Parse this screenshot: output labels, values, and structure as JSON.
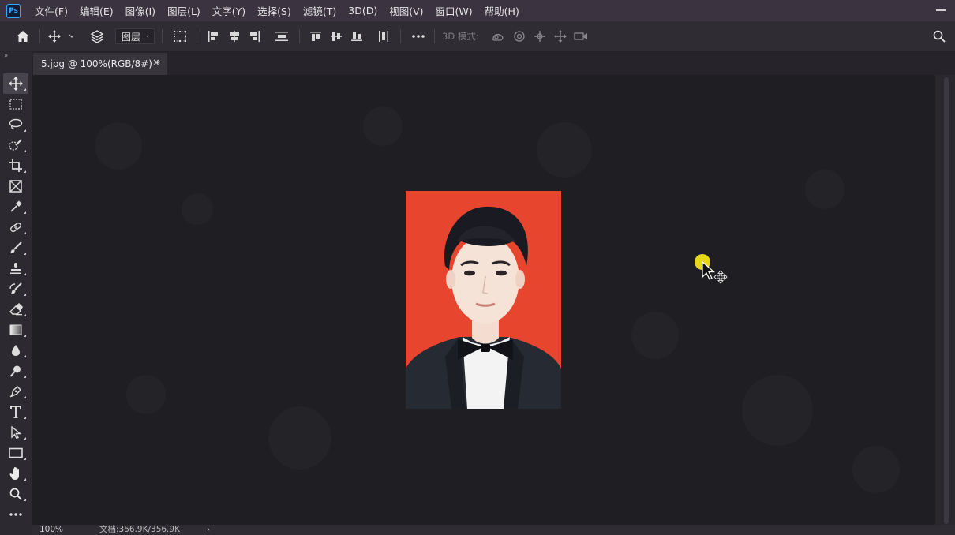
{
  "app": {
    "logo": "Ps",
    "menu": [
      "文件(F)",
      "编辑(E)",
      "图像(I)",
      "图层(L)",
      "文字(Y)",
      "选择(S)",
      "滤镜(T)",
      "3D(D)",
      "视图(V)",
      "窗口(W)",
      "帮助(H)"
    ]
  },
  "options_bar": {
    "auto_select_target": "图层",
    "mode_3d_label": "3D 模式:"
  },
  "document": {
    "tab_title": "5.jpg @ 100%(RGB/8#) *",
    "close_glyph": "×"
  },
  "status": {
    "zoom": "100%",
    "doc_size": "文档:356.9K/356.9K",
    "arrow": "›"
  },
  "toolbar": {
    "tools": [
      "move-tool",
      "rectangular-marquee-tool",
      "lasso-tool",
      "quick-selection-tool",
      "crop-tool",
      "frame-tool",
      "eyedropper-tool",
      "healing-brush-tool",
      "brush-tool",
      "clone-stamp-tool",
      "history-brush-tool",
      "eraser-tool",
      "gradient-tool",
      "blur-tool",
      "dodge-tool",
      "pen-tool",
      "type-tool",
      "path-selection-tool",
      "rectangle-tool",
      "hand-tool",
      "zoom-tool",
      "more-tools"
    ]
  },
  "colors": {
    "menubar": "#3b3340",
    "canvas": "#1f1e23",
    "photo_background": "#e8452f",
    "cursor_highlight": "#f2e21b"
  }
}
